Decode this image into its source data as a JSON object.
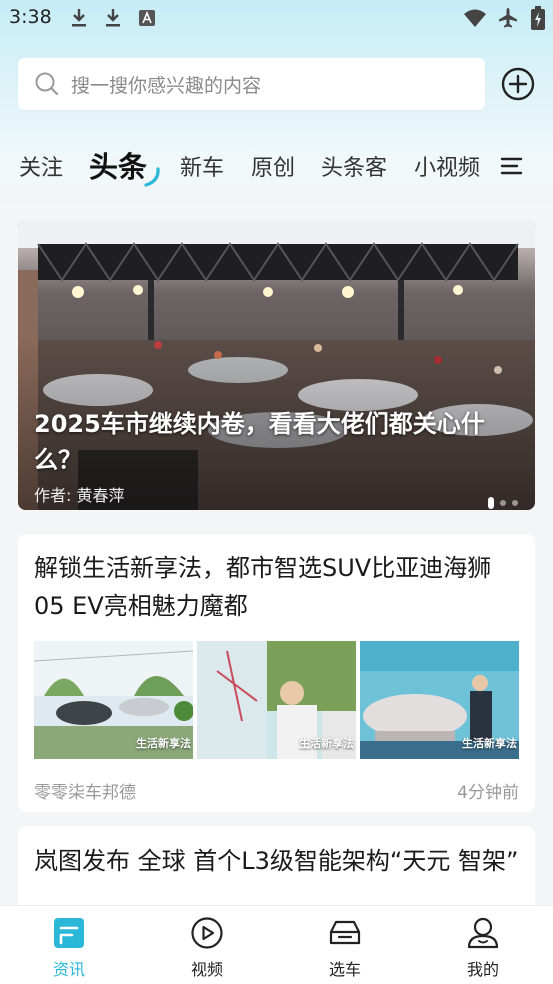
{
  "status_bar": {
    "time": "3:38"
  },
  "search": {
    "placeholder": "搜一搜你感兴趣的内容"
  },
  "tabs": [
    {
      "label": "关注",
      "active": false
    },
    {
      "label": "头条",
      "active": true
    },
    {
      "label": "新车",
      "active": false
    },
    {
      "label": "原创",
      "active": false
    },
    {
      "label": "头条客",
      "active": false
    },
    {
      "label": "小视频",
      "active": false
    }
  ],
  "banner": {
    "title": "2025车市继续内卷，看看大佬们都关心什么？",
    "author": "作者: 黄春萍",
    "page_count": 3,
    "current_page": 1
  },
  "articles": [
    {
      "title": "解锁生活新享法，都市智选SUV比亚迪海狮05 EV亮相魅力魔都",
      "image_captions": [
        "生活新享法",
        "生活新享法",
        "生活新享法"
      ],
      "source": "零零柒车邦德",
      "time": "4分钟前"
    },
    {
      "title": "岚图发布 全球 首个L3级智能架构“天元 智架”"
    }
  ],
  "bottom_nav": [
    {
      "label": "资讯",
      "icon": "news-icon",
      "active": true
    },
    {
      "label": "视频",
      "icon": "video-icon",
      "active": false
    },
    {
      "label": "选车",
      "icon": "car-icon",
      "active": false
    },
    {
      "label": "我的",
      "icon": "profile-icon",
      "active": false
    }
  ],
  "colors": {
    "accent": "#2bb7d8",
    "background": "#f4f5f7"
  }
}
